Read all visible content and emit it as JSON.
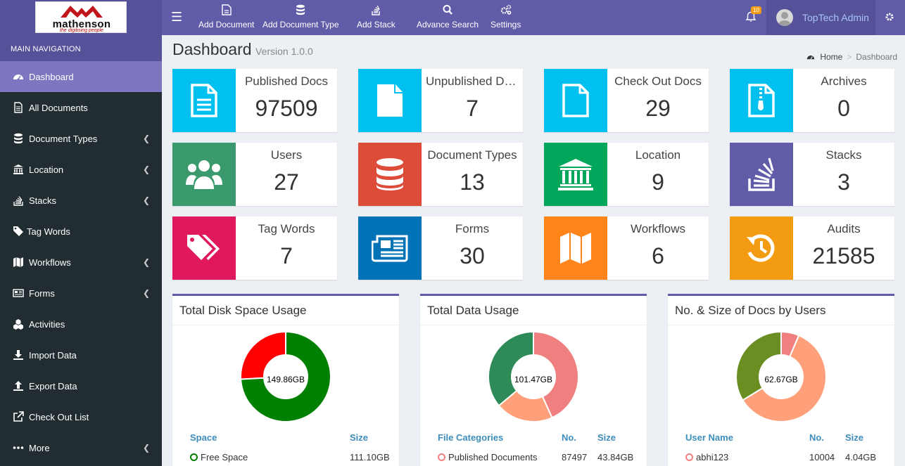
{
  "brand": {
    "logo_text": "mathenson",
    "logo_tagline": "the digitising people"
  },
  "top_actions": [
    {
      "label": "Add Document",
      "icon": "file-add-icon"
    },
    {
      "label": "Add Document Type",
      "icon": "database-icon"
    },
    {
      "label": "Add Stack",
      "icon": "stack-icon"
    },
    {
      "label": "Advance Search",
      "icon": "search-icon"
    },
    {
      "label": "Settings",
      "icon": "cogs-icon"
    }
  ],
  "notifications": {
    "count": "10"
  },
  "user": {
    "name": "TopTech Admin"
  },
  "sidebar": {
    "header": "MAIN NAVIGATION",
    "items": [
      {
        "label": "Dashboard",
        "icon": "dashboard-icon",
        "active": true
      },
      {
        "label": "All Documents",
        "icon": "file-text-icon"
      },
      {
        "label": "Document Types",
        "icon": "database-icon",
        "has_submenu": true
      },
      {
        "label": "Location",
        "icon": "bank-icon",
        "has_submenu": true
      },
      {
        "label": "Stacks",
        "icon": "stack-icon",
        "has_submenu": true
      },
      {
        "label": "Tag Words",
        "icon": "tag-icon"
      },
      {
        "label": "Workflows",
        "icon": "map-icon",
        "has_submenu": true
      },
      {
        "label": "Forms",
        "icon": "newspaper-icon",
        "has_submenu": true
      },
      {
        "label": "Activities",
        "icon": "cubes-icon"
      },
      {
        "label": "Import Data",
        "icon": "download-icon"
      },
      {
        "label": "Export Data",
        "icon": "upload-icon"
      },
      {
        "label": "Check Out List",
        "icon": "external-link-icon"
      },
      {
        "label": "More",
        "icon": "ellipsis-icon",
        "has_submenu": true
      }
    ]
  },
  "page": {
    "title": "Dashboard",
    "version": "Version 1.0.0"
  },
  "breadcrumb": {
    "home": "Home",
    "current": "Dashboard"
  },
  "info_boxes": [
    {
      "label": "Published Docs",
      "value": "97509",
      "color": "#00c0ef",
      "icon": "file-text-icon"
    },
    {
      "label": "Unpublished Docs",
      "value": "7",
      "color": "#00c0ef",
      "icon": "file-icon"
    },
    {
      "label": "Check Out Docs",
      "value": "29",
      "color": "#00c0ef",
      "icon": "file-outline-icon"
    },
    {
      "label": "Archives",
      "value": "0",
      "color": "#00c0ef",
      "icon": "file-archive-icon"
    },
    {
      "label": "Users",
      "value": "27",
      "color": "#3a9a6e",
      "icon": "users-icon"
    },
    {
      "label": "Document Types",
      "value": "13",
      "color": "#dd4b39",
      "icon": "database-icon"
    },
    {
      "label": "Location",
      "value": "9",
      "color": "#00a65a",
      "icon": "bank-icon"
    },
    {
      "label": "Stacks",
      "value": "3",
      "color": "#605ca8",
      "icon": "stack-icon"
    },
    {
      "label": "Tag Words",
      "value": "7",
      "color": "#e0195e",
      "icon": "tags-icon"
    },
    {
      "label": "Forms",
      "value": "30",
      "color": "#0073b7",
      "icon": "newspaper-icon"
    },
    {
      "label": "Workflows",
      "value": "6",
      "color": "#ff851b",
      "icon": "map-icon"
    },
    {
      "label": "Audits",
      "value": "21585",
      "color": "#f39c12",
      "icon": "history-icon"
    }
  ],
  "panels": [
    {
      "title": "Total Disk Space Usage",
      "center_label": "149.86GB",
      "segments": [
        {
          "value": 111.1,
          "color": "#008000"
        },
        {
          "value": 38.76,
          "color": "#ff0000"
        }
      ],
      "columns": [
        "Space",
        "Size"
      ],
      "rows": [
        {
          "name": "Free Space",
          "value": "111.10GB",
          "color": "#008000"
        }
      ]
    },
    {
      "title": "Total Data Usage",
      "center_label": "101.47GB",
      "segments": [
        {
          "value": 43.84,
          "color": "#f08080"
        },
        {
          "value": 21.0,
          "color": "#ffa07a"
        },
        {
          "value": 36.63,
          "color": "#2e8b57"
        }
      ],
      "columns": [
        "File Categories",
        "No.",
        "Size"
      ],
      "rows": [
        {
          "name": "Published Documents",
          "no": "87497",
          "value": "43.84GB",
          "color": "#f08080"
        }
      ]
    },
    {
      "title": "No. & Size of Docs by Users",
      "center_label": "62.67GB",
      "segments": [
        {
          "value": 4.04,
          "color": "#f08080"
        },
        {
          "value": 37.5,
          "color": "#ffa07a"
        },
        {
          "value": 21.13,
          "color": "#6b8e23"
        }
      ],
      "columns": [
        "User Name",
        "No.",
        "Size"
      ],
      "rows": [
        {
          "name": "abhi123",
          "no": "10004",
          "value": "4.04GB",
          "color": "#f08080"
        }
      ]
    }
  ]
}
